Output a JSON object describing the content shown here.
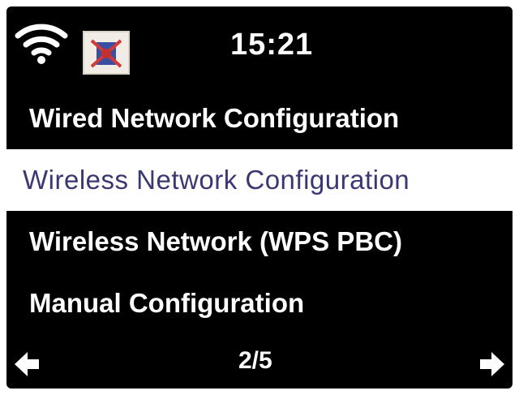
{
  "status_bar": {
    "time": "15:21",
    "wifi_icon": "wifi-icon",
    "app_icon": "app-logo-icon"
  },
  "menu": {
    "items": [
      {
        "label": "Wired Network Configuration",
        "selected": false
      },
      {
        "label": "Wireless Network Configuration",
        "selected": true
      },
      {
        "label": "Wireless Network (WPS PBC)",
        "selected": false
      },
      {
        "label": "Manual Configuration",
        "selected": false
      }
    ]
  },
  "footer": {
    "page": "2/5",
    "prev_icon": "arrow-left-icon",
    "next_icon": "arrow-right-icon"
  },
  "colors": {
    "background": "#000000",
    "text": "#ffffff",
    "selected_background": "#ffffff",
    "selected_text": "#3a3872"
  }
}
